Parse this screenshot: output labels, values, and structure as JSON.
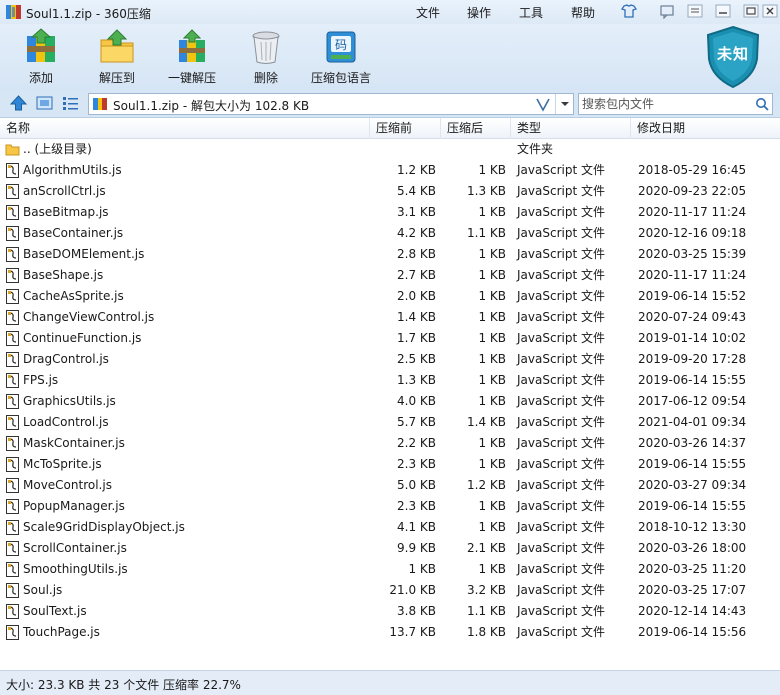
{
  "window": {
    "title": "Soul1.1.zip - 360压缩",
    "menu": [
      "文件",
      "操作",
      "工具",
      "帮助"
    ]
  },
  "toolbar": {
    "buttons": [
      "添加",
      "解压到",
      "一键解压",
      "删除",
      "压缩包语言"
    ],
    "lang_icon_text": "码",
    "badge_text": "未知"
  },
  "address": {
    "text": "Soul1.1.zip - 解包大小为 102.8 KB",
    "search_placeholder": "搜索包内文件"
  },
  "list": {
    "headers": [
      "名称",
      "压缩前",
      "压缩后",
      "类型",
      "修改日期"
    ],
    "parent": {
      "name": ".. (上级目录)",
      "type": "文件夹"
    },
    "rows": [
      {
        "name": "AlgorithmUtils.js",
        "size": "1.2 KB",
        "packed": "1 KB",
        "type": "JavaScript 文件",
        "date": "2018-05-29 16:45"
      },
      {
        "name": "anScrollCtrl.js",
        "size": "5.4 KB",
        "packed": "1.3 KB",
        "type": "JavaScript 文件",
        "date": "2020-09-23 22:05"
      },
      {
        "name": "BaseBitmap.js",
        "size": "3.1 KB",
        "packed": "1 KB",
        "type": "JavaScript 文件",
        "date": "2020-11-17 11:24"
      },
      {
        "name": "BaseContainer.js",
        "size": "4.2 KB",
        "packed": "1.1 KB",
        "type": "JavaScript 文件",
        "date": "2020-12-16 09:18"
      },
      {
        "name": "BaseDOMElement.js",
        "size": "2.8 KB",
        "packed": "1 KB",
        "type": "JavaScript 文件",
        "date": "2020-03-25 15:39"
      },
      {
        "name": "BaseShape.js",
        "size": "2.7 KB",
        "packed": "1 KB",
        "type": "JavaScript 文件",
        "date": "2020-11-17 11:24"
      },
      {
        "name": "CacheAsSprite.js",
        "size": "2.0 KB",
        "packed": "1 KB",
        "type": "JavaScript 文件",
        "date": "2019-06-14 15:52"
      },
      {
        "name": "ChangeViewControl.js",
        "size": "1.4 KB",
        "packed": "1 KB",
        "type": "JavaScript 文件",
        "date": "2020-07-24 09:43"
      },
      {
        "name": "ContinueFunction.js",
        "size": "1.7 KB",
        "packed": "1 KB",
        "type": "JavaScript 文件",
        "date": "2019-01-14 10:02"
      },
      {
        "name": "DragControl.js",
        "size": "2.5 KB",
        "packed": "1 KB",
        "type": "JavaScript 文件",
        "date": "2019-09-20 17:28"
      },
      {
        "name": "FPS.js",
        "size": "1.3 KB",
        "packed": "1 KB",
        "type": "JavaScript 文件",
        "date": "2019-06-14 15:55"
      },
      {
        "name": "GraphicsUtils.js",
        "size": "4.0 KB",
        "packed": "1 KB",
        "type": "JavaScript 文件",
        "date": "2017-06-12 09:54"
      },
      {
        "name": "LoadControl.js",
        "size": "5.7 KB",
        "packed": "1.4 KB",
        "type": "JavaScript 文件",
        "date": "2021-04-01 09:34"
      },
      {
        "name": "MaskContainer.js",
        "size": "2.2 KB",
        "packed": "1 KB",
        "type": "JavaScript 文件",
        "date": "2020-03-26 14:37"
      },
      {
        "name": "McToSprite.js",
        "size": "2.3 KB",
        "packed": "1 KB",
        "type": "JavaScript 文件",
        "date": "2019-06-14 15:55"
      },
      {
        "name": "MoveControl.js",
        "size": "5.0 KB",
        "packed": "1.2 KB",
        "type": "JavaScript 文件",
        "date": "2020-03-27 09:34"
      },
      {
        "name": "PopupManager.js",
        "size": "2.3 KB",
        "packed": "1 KB",
        "type": "JavaScript 文件",
        "date": "2019-06-14 15:55"
      },
      {
        "name": "Scale9GridDisplayObject.js",
        "size": "4.1 KB",
        "packed": "1 KB",
        "type": "JavaScript 文件",
        "date": "2018-10-12 13:30"
      },
      {
        "name": "ScrollContainer.js",
        "size": "9.9 KB",
        "packed": "2.1 KB",
        "type": "JavaScript 文件",
        "date": "2020-03-26 18:00"
      },
      {
        "name": "SmoothingUtils.js",
        "size": "1 KB",
        "packed": "1 KB",
        "type": "JavaScript 文件",
        "date": "2020-03-25 11:20"
      },
      {
        "name": "Soul.js",
        "size": "21.0 KB",
        "packed": "3.2 KB",
        "type": "JavaScript 文件",
        "date": "2020-03-25 17:07"
      },
      {
        "name": "SoulText.js",
        "size": "3.8 KB",
        "packed": "1.1 KB",
        "type": "JavaScript 文件",
        "date": "2020-12-14 14:43"
      },
      {
        "name": "TouchPage.js",
        "size": "13.7 KB",
        "packed": "1.8 KB",
        "type": "JavaScript 文件",
        "date": "2019-06-14 15:56"
      }
    ]
  },
  "status": {
    "text": "大小: 23.3 KB 共 23 个文件 压缩率 22.7%"
  },
  "colors": {
    "accent": "#1e6fc1",
    "badge": "#1b8fb0",
    "window_bg": "#dfeaf7"
  }
}
